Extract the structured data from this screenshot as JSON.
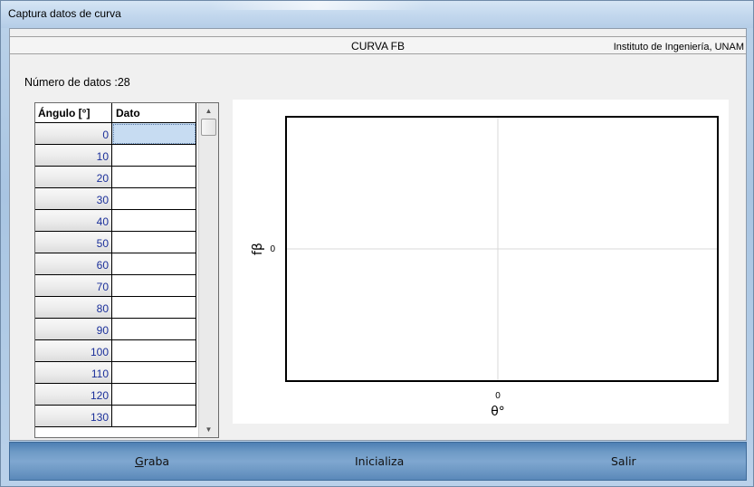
{
  "window": {
    "title": "Captura datos de curva"
  },
  "header": {
    "title": "CURVA FB",
    "institution": "Instituto de Ingeniería, UNAM"
  },
  "count_label": "Número de datos :28",
  "grid": {
    "columns": [
      "Ángulo [°]",
      "Dato"
    ],
    "rows": [
      {
        "angle": "0",
        "dato": ""
      },
      {
        "angle": "10",
        "dato": ""
      },
      {
        "angle": "20",
        "dato": ""
      },
      {
        "angle": "30",
        "dato": ""
      },
      {
        "angle": "40",
        "dato": ""
      },
      {
        "angle": "50",
        "dato": ""
      },
      {
        "angle": "60",
        "dato": ""
      },
      {
        "angle": "70",
        "dato": ""
      },
      {
        "angle": "80",
        "dato": ""
      },
      {
        "angle": "90",
        "dato": ""
      },
      {
        "angle": "100",
        "dato": ""
      },
      {
        "angle": "110",
        "dato": ""
      },
      {
        "angle": "120",
        "dato": ""
      },
      {
        "angle": "130",
        "dato": ""
      }
    ],
    "selected_row": 0
  },
  "chart": {
    "ylabel": "fβ",
    "xlabel": "θ°",
    "x_tick": "0",
    "y_tick": "0"
  },
  "buttons": {
    "graba": {
      "accel": "G",
      "rest": "raba"
    },
    "inicializa": "Inicializa",
    "salir": "Salir"
  },
  "colors": {
    "angle_text": "#1a2f9a",
    "selected_cell": "#c7dcf2",
    "bottom_bar": "#6e9ac6"
  }
}
